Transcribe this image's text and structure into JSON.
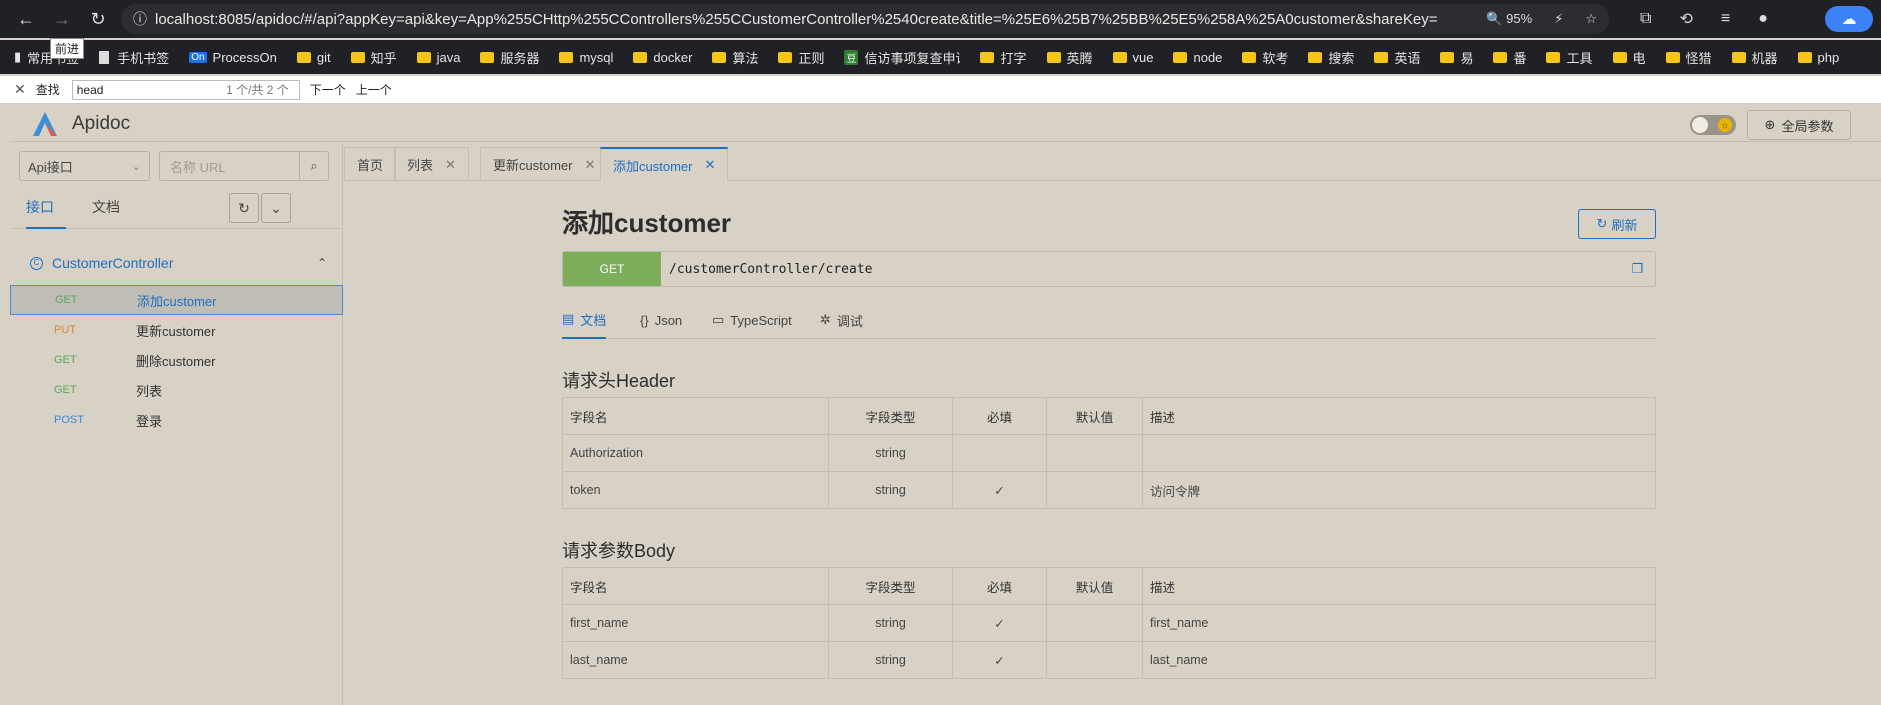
{
  "browser": {
    "url": "localhost:8085/apidoc/#/api?appKey=api&key=App%255CHttp%255CControllers%255CCustomerController%2540create&title=%25E6%25B7%25BB%25E5%258A%25A0customer&shareKey=",
    "zoom": "95%",
    "tooltip": "前进",
    "bookmarks": [
      "常用书签",
      "手机书签",
      "ProcessOn",
      "git",
      "知乎",
      "java",
      "服务器",
      "mysql",
      "docker",
      "算法",
      "正则",
      "信访事项复查申请",
      "打字",
      "英腾",
      "vue",
      "node",
      "软考",
      "搜索",
      "英语",
      "易",
      "番",
      "工具",
      "电",
      "怪猎",
      "机器",
      "php"
    ],
    "bookmark_badge_processon": "On",
    "bookmark_badge_xinfang": "豆"
  },
  "findbar": {
    "label": "查找",
    "query": "head",
    "count": "1 个/共 2 个",
    "next": "下一个",
    "prev": "上一个"
  },
  "app": {
    "name": "Apidoc",
    "global_params": "全局参数"
  },
  "sidebar": {
    "select_value": "Api接口",
    "search_placeholder": "名称 URL",
    "tabs": [
      "接口",
      "文档"
    ],
    "group": "CustomerController",
    "items": [
      {
        "method": "GET",
        "name": "添加customer"
      },
      {
        "method": "PUT",
        "name": "更新customer"
      },
      {
        "method": "GET",
        "name": "删除customer"
      },
      {
        "method": "GET",
        "name": "列表"
      },
      {
        "method": "POST",
        "name": "登录"
      }
    ]
  },
  "tabs": [
    {
      "label": "首页"
    },
    {
      "label": "列表"
    },
    {
      "label": "更新customer"
    },
    {
      "label": "添加customer"
    }
  ],
  "doc": {
    "title": "添加customer",
    "refresh": "刷新",
    "method": "GET",
    "path": "/customerController/create",
    "tabs": [
      "文档",
      "Json",
      "TypeScript",
      "调试"
    ],
    "header_section": "请求头Header",
    "body_section": "请求参数Body",
    "columns": [
      "字段名",
      "字段类型",
      "必填",
      "默认值",
      "描述"
    ],
    "header_rows": [
      {
        "name": "Authorization",
        "type": "string",
        "required": "",
        "default": "",
        "desc": ""
      },
      {
        "name": "token",
        "type": "string",
        "required": "✓",
        "default": "",
        "desc": "访问令牌"
      }
    ],
    "body_rows": [
      {
        "name": "first_name",
        "type": "string",
        "required": "✓",
        "default": "",
        "desc": "first_name"
      },
      {
        "name": "last_name",
        "type": "string",
        "required": "✓",
        "default": "",
        "desc": "last_name"
      }
    ]
  }
}
